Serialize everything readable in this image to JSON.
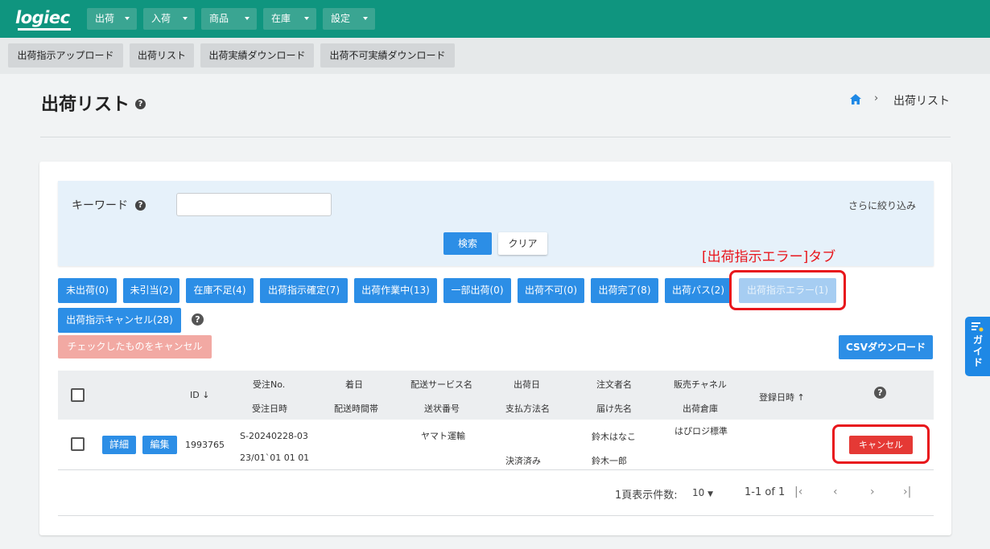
{
  "brand": {
    "logo": "logiec"
  },
  "topnav": [
    "出荷",
    "入荷",
    "商品",
    "在庫",
    "設定"
  ],
  "subnav": [
    "出荷指示アップロード",
    "出荷リスト",
    "出荷実績ダウンロード",
    "出荷不可実績ダウンロード"
  ],
  "page": {
    "title": "出荷リスト",
    "breadcrumb": "出荷リスト"
  },
  "search": {
    "keyword_label": "キーワード",
    "keyword_value": "",
    "narrow_link": "さらに絞り込み",
    "search_button": "検索",
    "clear_button": "クリア"
  },
  "annotation": {
    "text": "[出荷指示エラー]タブ",
    "color": "#e8161c"
  },
  "status_tabs": [
    "未出荷(0)",
    "未引当(2)",
    "在庫不足(4)",
    "出荷指示確定(7)",
    "出荷作業中(13)",
    "一部出荷(0)",
    "出荷不可(0)",
    "出荷完了(8)",
    "出荷パス(2)",
    "出荷指示エラー(1)",
    "出荷指示キャンセル(28)"
  ],
  "active_tab": "出荷指示エラー(1)",
  "actions": {
    "bulk_cancel": "チェックしたものをキャンセル",
    "csv_download": "CSVダウンロード"
  },
  "table": {
    "headers": {
      "id": "ID",
      "order_no": "受注No.",
      "order_date": "受注日時",
      "arrival_date": "着日",
      "delivery_time": "配送時間帯",
      "delivery_service": "配送サービス名",
      "tracking_no": "送状番号",
      "ship_date": "出荷日",
      "payment_method": "支払方法名",
      "orderer": "注文者名",
      "recipient": "届け先名",
      "sales_channel": "販売チャネル",
      "warehouse": "出荷倉庫",
      "registered_at": "登録日時"
    },
    "rows": [
      {
        "detail_button": "詳細",
        "edit_button": "編集",
        "id": "1993765",
        "order_no": "S-20240228-03",
        "order_date": "23/01`01 01 01",
        "arrival_date": "",
        "delivery_time": "",
        "delivery_service": "ヤマト運輸",
        "tracking_no": "",
        "ship_date": "",
        "payment_method": "決済済み",
        "orderer": "鈴木はなこ",
        "recipient": "鈴木一郎",
        "sales_channel": "はぴロジ標準",
        "warehouse": "",
        "registered_at": "",
        "cancel_button": "キャンセル"
      }
    ]
  },
  "pagination": {
    "per_page_label": "1頁表示件数:",
    "per_page_value": "10",
    "range": "1-1 of 1"
  },
  "guide_tab": "ガイド",
  "colors": {
    "header": "#0f957f",
    "primary": "#2c8ee6",
    "danger": "#e53935",
    "annotation": "#e8161c"
  }
}
